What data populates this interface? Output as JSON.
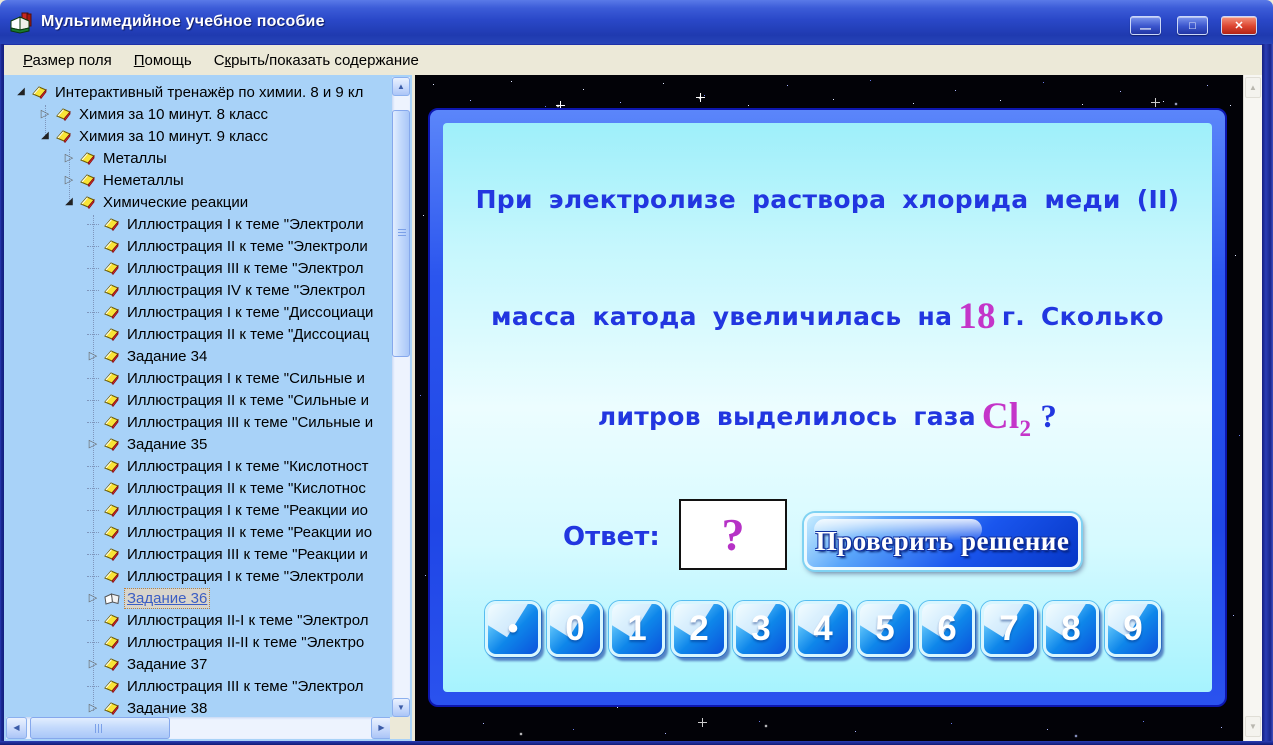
{
  "window": {
    "title": "Мультимедийное учебное пособие",
    "controls": {
      "minimize": "—",
      "maximize": "□",
      "close": "✕"
    }
  },
  "menu": {
    "items": [
      {
        "label": "Размер поля",
        "accelerator": "Р"
      },
      {
        "label": "Помощь",
        "accelerator": "П"
      },
      {
        "label": "Скрыть/показать содержание",
        "accelerator": "к"
      }
    ]
  },
  "tree": {
    "items": [
      {
        "label": "Интерактивный тренажёр по химии. 8 и 9 кл",
        "level": 0,
        "expander": "expanded"
      },
      {
        "label": "Химия за 10 минут. 8 класс",
        "level": 1,
        "expander": "collapsed"
      },
      {
        "label": "Химия за 10 минут. 9 класс",
        "level": 1,
        "expander": "expanded"
      },
      {
        "label": "Металлы",
        "level": 2,
        "expander": "collapsed"
      },
      {
        "label": "Неметаллы",
        "level": 2,
        "expander": "collapsed"
      },
      {
        "label": "Химические реакции",
        "level": 2,
        "expander": "expanded"
      },
      {
        "label": "Иллюстрация I к теме \"Электроли",
        "level": 3,
        "expander": "none"
      },
      {
        "label": "Иллюстрация II к теме \"Электроли",
        "level": 3,
        "expander": "none"
      },
      {
        "label": "Иллюстрация III к теме \"Электрол",
        "level": 3,
        "expander": "none"
      },
      {
        "label": "Иллюстрация IV к теме \"Электрол",
        "level": 3,
        "expander": "none"
      },
      {
        "label": "Иллюстрация I к теме \"Диссоциаци",
        "level": 3,
        "expander": "none"
      },
      {
        "label": "Иллюстрация II к теме \"Диссоциац",
        "level": 3,
        "expander": "none"
      },
      {
        "label": "Задание 34",
        "level": 3,
        "expander": "collapsed"
      },
      {
        "label": "Иллюстрация I к теме \"Сильные и",
        "level": 3,
        "expander": "none"
      },
      {
        "label": "Иллюстрация II к теме \"Сильные и",
        "level": 3,
        "expander": "none"
      },
      {
        "label": "Иллюстрация III к теме \"Сильные и",
        "level": 3,
        "expander": "none"
      },
      {
        "label": "Задание 35",
        "level": 3,
        "expander": "collapsed"
      },
      {
        "label": "Иллюстрация I к теме \"Кислотност",
        "level": 3,
        "expander": "none"
      },
      {
        "label": "Иллюстрация II к теме \"Кислотнос",
        "level": 3,
        "expander": "none"
      },
      {
        "label": "Иллюстрация I к теме \"Реакции ио",
        "level": 3,
        "expander": "none"
      },
      {
        "label": "Иллюстрация II к теме \"Реакции ио",
        "level": 3,
        "expander": "none"
      },
      {
        "label": "Иллюстрация III к теме \"Реакции и",
        "level": 3,
        "expander": "none"
      },
      {
        "label": "Иллюстрация I к теме \"Электроли",
        "level": 3,
        "expander": "none"
      },
      {
        "label": "Задание 36",
        "level": 3,
        "expander": "collapsed",
        "selected": true
      },
      {
        "label": "Иллюстрация II-I к теме \"Электрол",
        "level": 3,
        "expander": "none"
      },
      {
        "label": "Иллюстрация II-II к теме \"Электро",
        "level": 3,
        "expander": "none"
      },
      {
        "label": "Задание 37",
        "level": 3,
        "expander": "collapsed"
      },
      {
        "label": "Иллюстрация III к теме \"Электрол",
        "level": 3,
        "expander": "none"
      },
      {
        "label": "Задание 38",
        "level": 3,
        "expander": "collapsed"
      }
    ]
  },
  "question": {
    "line1": "При электролизе раствора хлорида меди (II)",
    "line2_pre": "масса катода увеличилась на",
    "line2_value": "18",
    "line2_post": "г. Сколько",
    "line3_pre": "литров выделилось газа",
    "line3_formula": "Cl",
    "line3_subscript": "2",
    "line3_question_mark": "?"
  },
  "answer": {
    "label": "Ответ:",
    "value": "?",
    "check_button": "Проверить решение"
  },
  "keypad": {
    "keys": [
      "•",
      "0",
      "1",
      "2",
      "3",
      "4",
      "5",
      "6",
      "7",
      "8",
      "9"
    ]
  },
  "icons": {
    "expander_expanded": "◢",
    "expander_collapsed": "▷",
    "scroll_up": "▲",
    "scroll_down": "▼",
    "scroll_left": "◀",
    "scroll_right": "▶"
  },
  "colors": {
    "titlebar_blue": "#2a48c8",
    "menu_bg": "#ece9d8",
    "tree_bg": "#a8d2f8",
    "panel_frame_blue": "#2b55ee",
    "panel_content_cyan": "#c6f7fd",
    "question_text_blue": "#2236e0",
    "highlight_magenta": "#c435c9",
    "stage_black": "#020207"
  }
}
